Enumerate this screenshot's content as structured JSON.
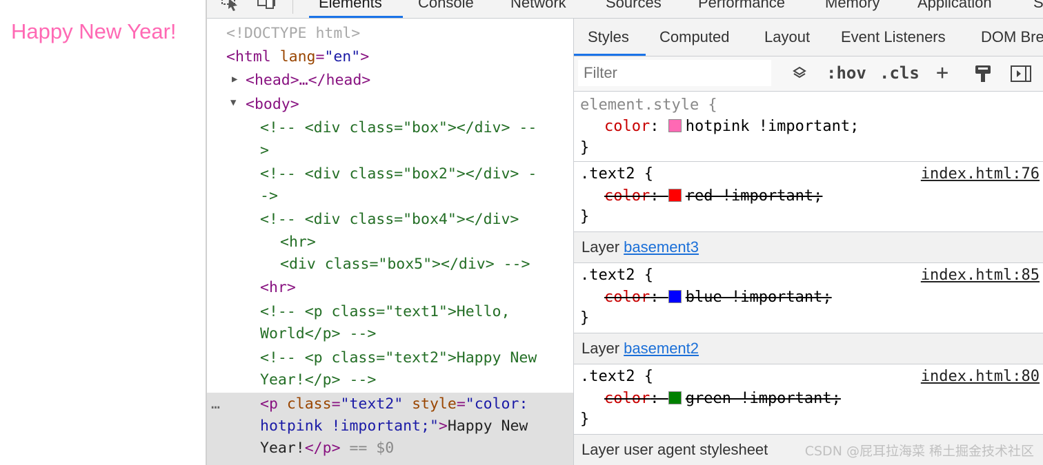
{
  "page": {
    "text": "Happy New Year!"
  },
  "devtools": {
    "main_tabs": [
      "Elements",
      "Console",
      "Network",
      "Sources",
      "Performance",
      "Memory",
      "Application",
      "S"
    ],
    "elements_tree": {
      "doctype": "<!DOCTYPE html>",
      "html_open": "<html",
      "html_lang_attr": "lang",
      "html_lang_val": "\"en\"",
      "html_close_bracket": ">",
      "head_line": "<head>…</head>",
      "body_open": "<body>",
      "c1a": "<!-- <div class=\"box\"></div> --",
      "c1b": ">",
      "c2a": "<!-- <div class=\"box2\"></div> -",
      "c2b": "->",
      "c3a": "<!-- <div class=\"box4\"></div>",
      "c3b": "<hr>",
      "c3c": "<div class=\"box5\"></div> -->",
      "hr": "<hr>",
      "c4a": "<!-- <p class=\"text1\">Hello,",
      "c4b": "World</p> -->",
      "c5a": "<!-- <p class=\"text2\">Happy New",
      "c5b": "Year!</p> -->",
      "sel_ellipsis": "…",
      "sel_p_open": "<p",
      "sel_class_attr": "class",
      "sel_class_val": "\"text2\"",
      "sel_style_attr": "style",
      "sel_style_val_a": "\"color:",
      "sel_style_val_b": "hotpink !important;\"",
      "sel_text_a": "Happy New",
      "sel_text_b": "Year!",
      "sel_p_close": "</p>",
      "sel_eq": "== $0"
    },
    "styles_tabs": [
      "Styles",
      "Computed",
      "Layout",
      "Event Listeners",
      "DOM Bre"
    ],
    "filter_placeholder": "Filter",
    "toolbar": {
      "hov": ":hov",
      "cls": ".cls",
      "add": "+"
    },
    "rules": [
      {
        "selector": "element.style {",
        "prop": "color",
        "value": "hotpink !important;",
        "swatch": "#ff69b4",
        "source": "",
        "strike": false
      },
      {
        "selector": ".text2 {",
        "prop": "color",
        "value": "red !important;",
        "swatch": "#ff0000",
        "source": "index.html:76",
        "strike": true
      },
      {
        "selector": ".text2 {",
        "prop": "color",
        "value": "blue !important;",
        "swatch": "#0000ff",
        "source": "index.html:85",
        "strike": true
      },
      {
        "selector": ".text2 {",
        "prop": "color",
        "value": "green !important;",
        "swatch": "#008000",
        "source": "index.html:80",
        "strike": true
      }
    ],
    "layers": [
      {
        "label": "Layer ",
        "link": "basement3"
      },
      {
        "label": "Layer ",
        "link": "basement2"
      },
      {
        "label": "Layer user agent stylesheet",
        "link": ""
      }
    ],
    "close_brace": "}",
    "watermark": "CSDN @屁耳拉海菜 稀土掘金技术社区"
  }
}
